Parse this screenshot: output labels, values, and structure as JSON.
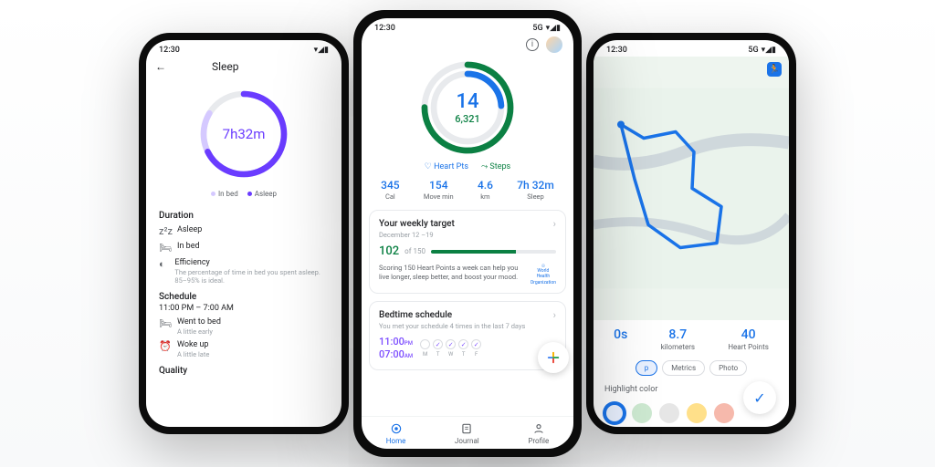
{
  "status": {
    "time": "12:30",
    "net": "5G"
  },
  "left": {
    "title": "Sleep",
    "ring_value": "7h32m",
    "legend_inbed": "In bed",
    "legend_asleep": "Asleep",
    "sec_duration": "Duration",
    "row_asleep": "Asleep",
    "row_inbed": "In bed",
    "row_eff": "Efficiency",
    "row_eff_sub": "The percentage of time in bed you spent asleep. 85–95% is ideal.",
    "sec_schedule": "Schedule",
    "schedule_sub": "11:00 PM – 7:00 AM",
    "row_went": "Went to bed",
    "row_went_sub": "A little early",
    "row_woke": "Woke up",
    "row_woke_sub": "A little late",
    "sec_quality": "Quality"
  },
  "center": {
    "ring_pts": "14",
    "ring_steps": "6,321",
    "leg_hp": "Heart Pts",
    "leg_steps": "Steps",
    "stats": [
      {
        "n": "345",
        "l": "Cal"
      },
      {
        "n": "154",
        "l": "Move min"
      },
      {
        "n": "4.6",
        "l": "km"
      },
      {
        "n": "7h 32m",
        "l": "Sleep"
      }
    ],
    "weekly_title": "Your weekly target",
    "weekly_dates": "December 12 –19",
    "weekly_num": "102",
    "weekly_of": "of 150",
    "weekly_desc": "Scoring 150 Heart Points a week can help you live longer, sleep better, and boost your mood.",
    "who_label": "World Health Organization",
    "bed_title": "Bedtime schedule",
    "bed_sub": "You met your schedule 4 times in the last 7 days",
    "bed_from": "11:00",
    "bed_from_ampm": "PM",
    "bed_to": "07:00",
    "bed_to_ampm": "AM",
    "days": [
      "M",
      "T",
      "W",
      "T",
      "F"
    ],
    "nav_home": "Home",
    "nav_journal": "Journal",
    "nav_profile": "Profile"
  },
  "right": {
    "activity_label": "on run",
    "stats": [
      {
        "n": "0s",
        "l": ""
      },
      {
        "n": "8.7",
        "l": "kilometers"
      },
      {
        "n": "40",
        "l": "Heart Points"
      }
    ],
    "chip_map": "p",
    "chip_metrics": "Metrics",
    "chip_photo": "Photo",
    "hl_title": "Highlight color",
    "colors": [
      "#1a73e8",
      "#cde9d1",
      "#e6e6e6",
      "#ffe08a",
      "#f6b9ac"
    ]
  }
}
